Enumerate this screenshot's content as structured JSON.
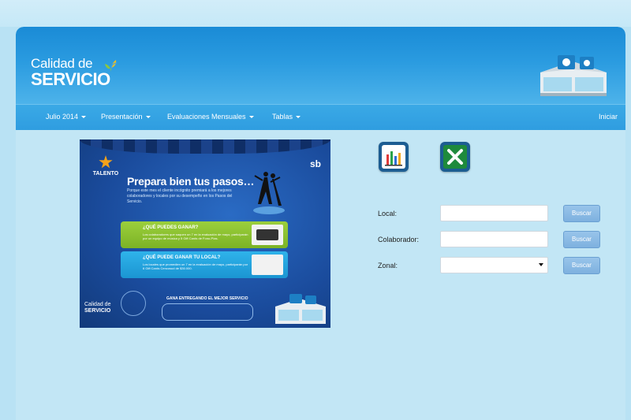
{
  "brand": {
    "logo_top": "Calidad de",
    "logo_bottom": "SERVICIO"
  },
  "nav": {
    "items": [
      {
        "label": "Julio 2014",
        "has_caret": true
      },
      {
        "label": "Presentación",
        "has_caret": true
      },
      {
        "label": "Evaluaciones Mensuales",
        "has_caret": true
      },
      {
        "label": "Tablas",
        "has_caret": true
      }
    ],
    "right_label": "Iniciar"
  },
  "banner": {
    "badge": "TALENTO",
    "sb": "sb",
    "title": "Prepara bien tus pasos…",
    "intro": "Porque este mes el cliente incógnito premiará a los mejores colaboradores y locales por su desempeño en los Pasos del Servicio.",
    "panel1_title": "¿QUÉ PUEDES GANAR?",
    "panel1_text": "Los colaboradores que saquen un 7 en la evaluación de mayo, participarán por un equipo de música y 5 Gift Cards de Fono-Pías.",
    "panel2_title": "¿QUÉ PUEDE GANAR TU LOCAL?",
    "panel2_text": "Los locales que promedien un 7 en la evaluación de mayo, participarán por 6 Gift Cards Cencosud de $30.000.",
    "footer_tagline": "GANA ENTREGANDO EL MEJOR SERVICIO",
    "footer_logo_top": "Calidad de",
    "footer_logo_bottom": "SERVICIO"
  },
  "tools": {
    "chart_icon": "bar-chart-icon",
    "excel_icon": "excel-icon"
  },
  "form": {
    "local_label": "Local:",
    "colaborador_label": "Colaborador:",
    "zonal_label": "Zonal:",
    "local_value": "",
    "colaborador_value": "",
    "zonal_value": "",
    "button_label": "Buscar"
  },
  "colors": {
    "header": "#1a8bd6",
    "nav": "#2f9de0",
    "page": "#c2e6f5",
    "button": "#7eb1df",
    "excel": "#1e8a3c"
  }
}
